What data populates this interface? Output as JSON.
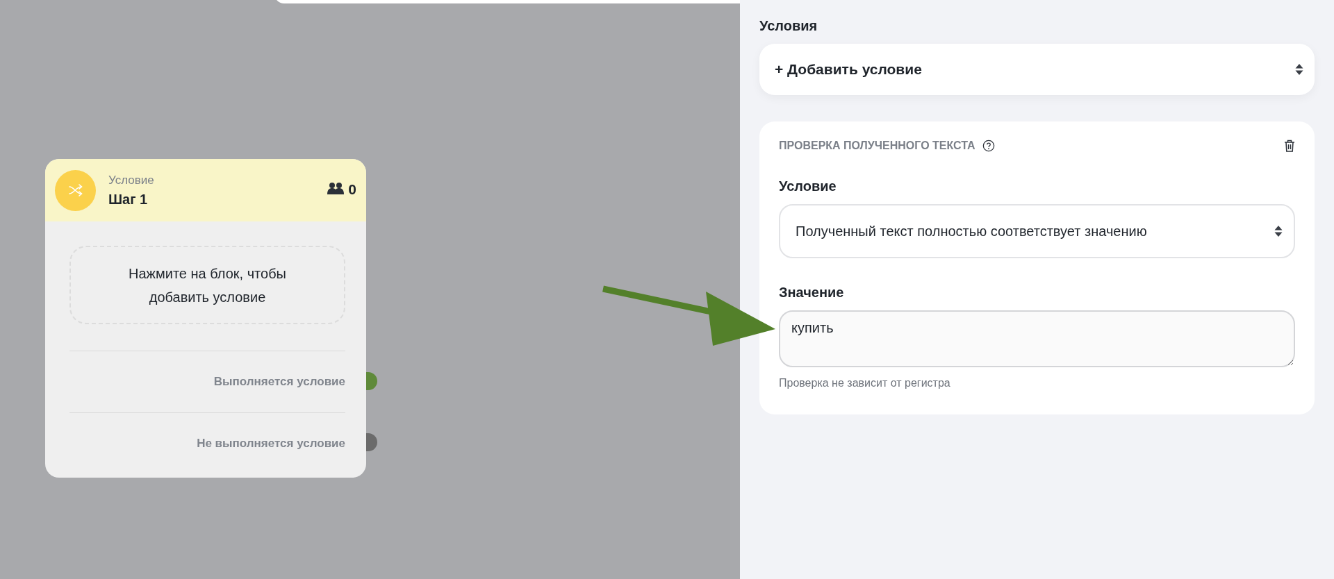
{
  "canvas": {
    "node": {
      "type_label": "Условие",
      "title": "Шаг 1",
      "subscriber_count": "0",
      "placeholder_text": "Нажмите на блок, чтобы добавить условие",
      "outputs": [
        {
          "label": "Выполняется условие",
          "color": "#5f8a3a"
        },
        {
          "label": "Не выполняется условие",
          "color": "#6b6b6b"
        }
      ]
    }
  },
  "panel": {
    "section_title": "Условия",
    "add_select": "+ Добавить условие",
    "condition_card": {
      "title": "ПРОВЕРКА ПОЛУЧЕННОГО ТЕКСТА",
      "fields": [
        {
          "kind": "select",
          "label": "Условие",
          "value": "Полученный текст полностью соответствует значению"
        },
        {
          "kind": "textarea",
          "label": "Значение",
          "value": "купить",
          "hint": "Проверка не зависит от регистра"
        }
      ]
    }
  }
}
